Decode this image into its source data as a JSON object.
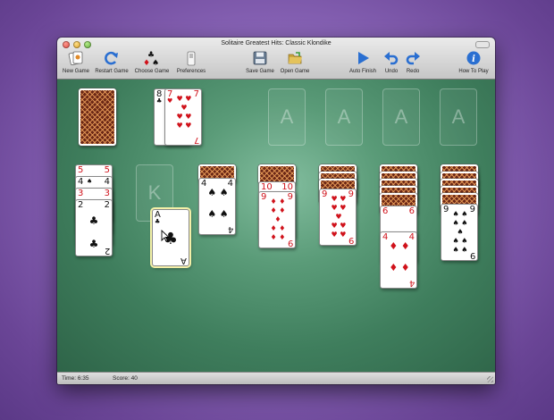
{
  "window": {
    "title": "Solitaire Greatest Hits: Classic Klondike"
  },
  "toolbar": {
    "new_game": "New Game",
    "restart_game": "Restart Game",
    "choose_game": "Choose Game",
    "preferences": "Preferences",
    "save_game": "Save Game",
    "open_game": "Open Game",
    "auto_finish": "Auto Finish",
    "undo": "Undo",
    "redo": "Redo",
    "how_to_play": "How To Play"
  },
  "status": {
    "time": "Time: 6:35",
    "score": "Score: 40"
  },
  "foundations": [
    "A",
    "A",
    "A",
    "A"
  ],
  "empty_slot": "K",
  "waste": {
    "under": {
      "rank": "8",
      "suit": "♣"
    },
    "top": {
      "rank": "7",
      "suit": "♥"
    }
  },
  "tableau": {
    "col1": [
      "5",
      "4",
      "3",
      "2"
    ],
    "col1_suits": [
      "♥",
      "♠",
      "♥",
      "♣"
    ],
    "dragged": {
      "rank": "A",
      "suit": "♣"
    },
    "col3": {
      "rank": "4",
      "suit": "♠"
    },
    "col4": {
      "under": {
        "rank": "10",
        "suit": "♦"
      },
      "top": {
        "rank": "9",
        "suit": "♦"
      }
    },
    "col5": {
      "rank": "9",
      "suit": "♥"
    },
    "col6": [
      "6",
      "4"
    ],
    "col6_suits": [
      "♦",
      "♦"
    ],
    "col7": {
      "rank": "9",
      "suit": "♠"
    }
  },
  "colors": {
    "felt": "#3f7e5d",
    "red_suit": "#d0121b",
    "card_back": "#6b2716",
    "accent": "#2a6fd1"
  }
}
